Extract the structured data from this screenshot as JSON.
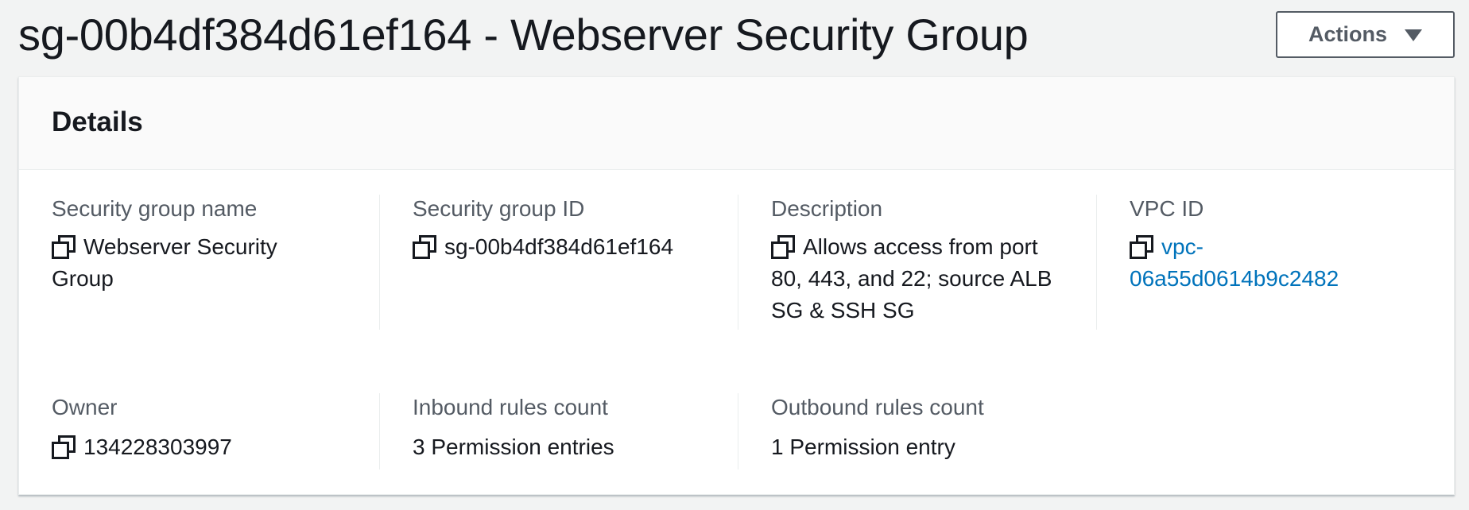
{
  "header": {
    "title": "sg-00b4df384d61ef164 - Webserver Security Group",
    "actions_label": "Actions"
  },
  "details": {
    "title": "Details",
    "security_group_name": {
      "label": "Security group name",
      "value": "Webserver Security Group"
    },
    "security_group_id": {
      "label": "Security group ID",
      "value": "sg-00b4df384d61ef164"
    },
    "description": {
      "label": "Description",
      "value": "Allows access from port 80, 443, and 22; source ALB SG & SSH SG"
    },
    "vpc_id": {
      "label": "VPC ID",
      "value": "vpc-06a55d0614b9c2482",
      "line1": "vpc-",
      "line2": "06a55d0614b9c2482"
    },
    "owner": {
      "label": "Owner",
      "value": "134228303997"
    },
    "inbound_rules_count": {
      "label": "Inbound rules count",
      "value": "3 Permission entries"
    },
    "outbound_rules_count": {
      "label": "Outbound rules count",
      "value": "1 Permission entry"
    }
  },
  "icons": {
    "copy": "copy-icon",
    "caret": "caret-down-icon"
  },
  "colors": {
    "link": "#0073bb",
    "page_background": "#f2f3f3",
    "panel_header_background": "#fafafa",
    "text_primary": "#16191f",
    "text_secondary": "#545b64"
  }
}
